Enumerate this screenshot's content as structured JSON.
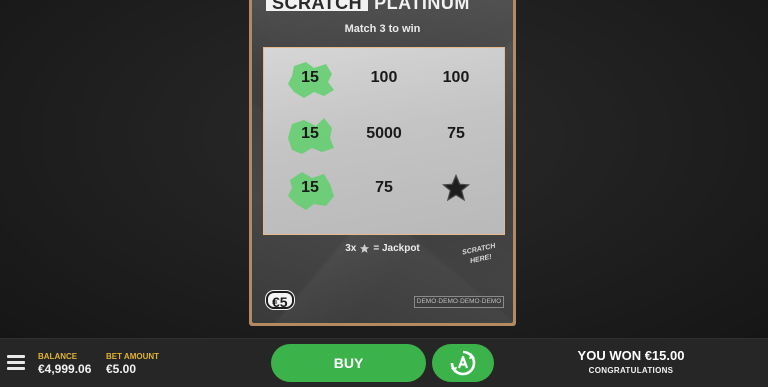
{
  "card": {
    "logo_left": "SCRATCH",
    "logo_right": "PLATINUM",
    "subtitle": "Match 3 to win",
    "grid": [
      [
        "15",
        "100",
        "100"
      ],
      [
        "15",
        "5000",
        "75"
      ],
      [
        "15",
        "75",
        "star"
      ]
    ],
    "winning_column": 0,
    "jackpot_prefix": "3x",
    "jackpot_suffix": "= Jackpot",
    "scratch_hint_line1": "SCRATCH",
    "scratch_hint_line2": "HERE!",
    "price": "€5",
    "demo_label": "DEMO·DEMO·DEMO·DEMO"
  },
  "bottom_bar": {
    "balance_label": "BALANCE",
    "balance_value": "€4,999.06",
    "bet_label": "BET AMOUNT",
    "bet_value": "€5.00",
    "buy_label": "BUY",
    "won_amount": "YOU WON €15.00",
    "won_message": "CONGRATULATIONS"
  },
  "colors": {
    "accent_green": "#3bb34a",
    "win_splash": "#5fcf6b",
    "label_gold": "#e0b332",
    "card_border": "#b48a62"
  },
  "icons": {
    "menu": "hamburger-menu-icon",
    "autoplay": "autoplay-icon",
    "jackpot_symbol": "star-icon"
  }
}
